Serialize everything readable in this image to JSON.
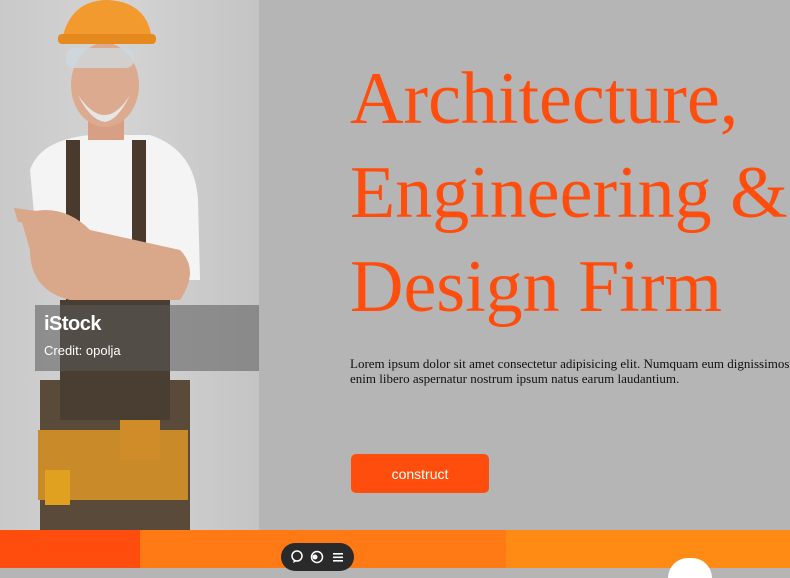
{
  "hero": {
    "headline_lines": [
      "Architecture,",
      "Engineering &",
      "Design Firm"
    ],
    "description_lines": [
      "Lorem ipsum dolor sit amet consectetur adipisicing elit. Numquam eum dignissimos",
      "enim libero aspernatur nostrum ipsum natus earum laudantium."
    ],
    "cta_label": "construct"
  },
  "image": {
    "watermark_brand": "iStock",
    "watermark_credit": "Credit: opolja"
  },
  "toolbar": {
    "icons": [
      "chat-bubble-icon",
      "toggle-icon",
      "menu-lines-icon"
    ]
  },
  "colors": {
    "accent": "#ff4d0d",
    "strip_mid": "#ff7a14",
    "strip_right": "#ff8a14",
    "background": "#b5b5b5"
  }
}
